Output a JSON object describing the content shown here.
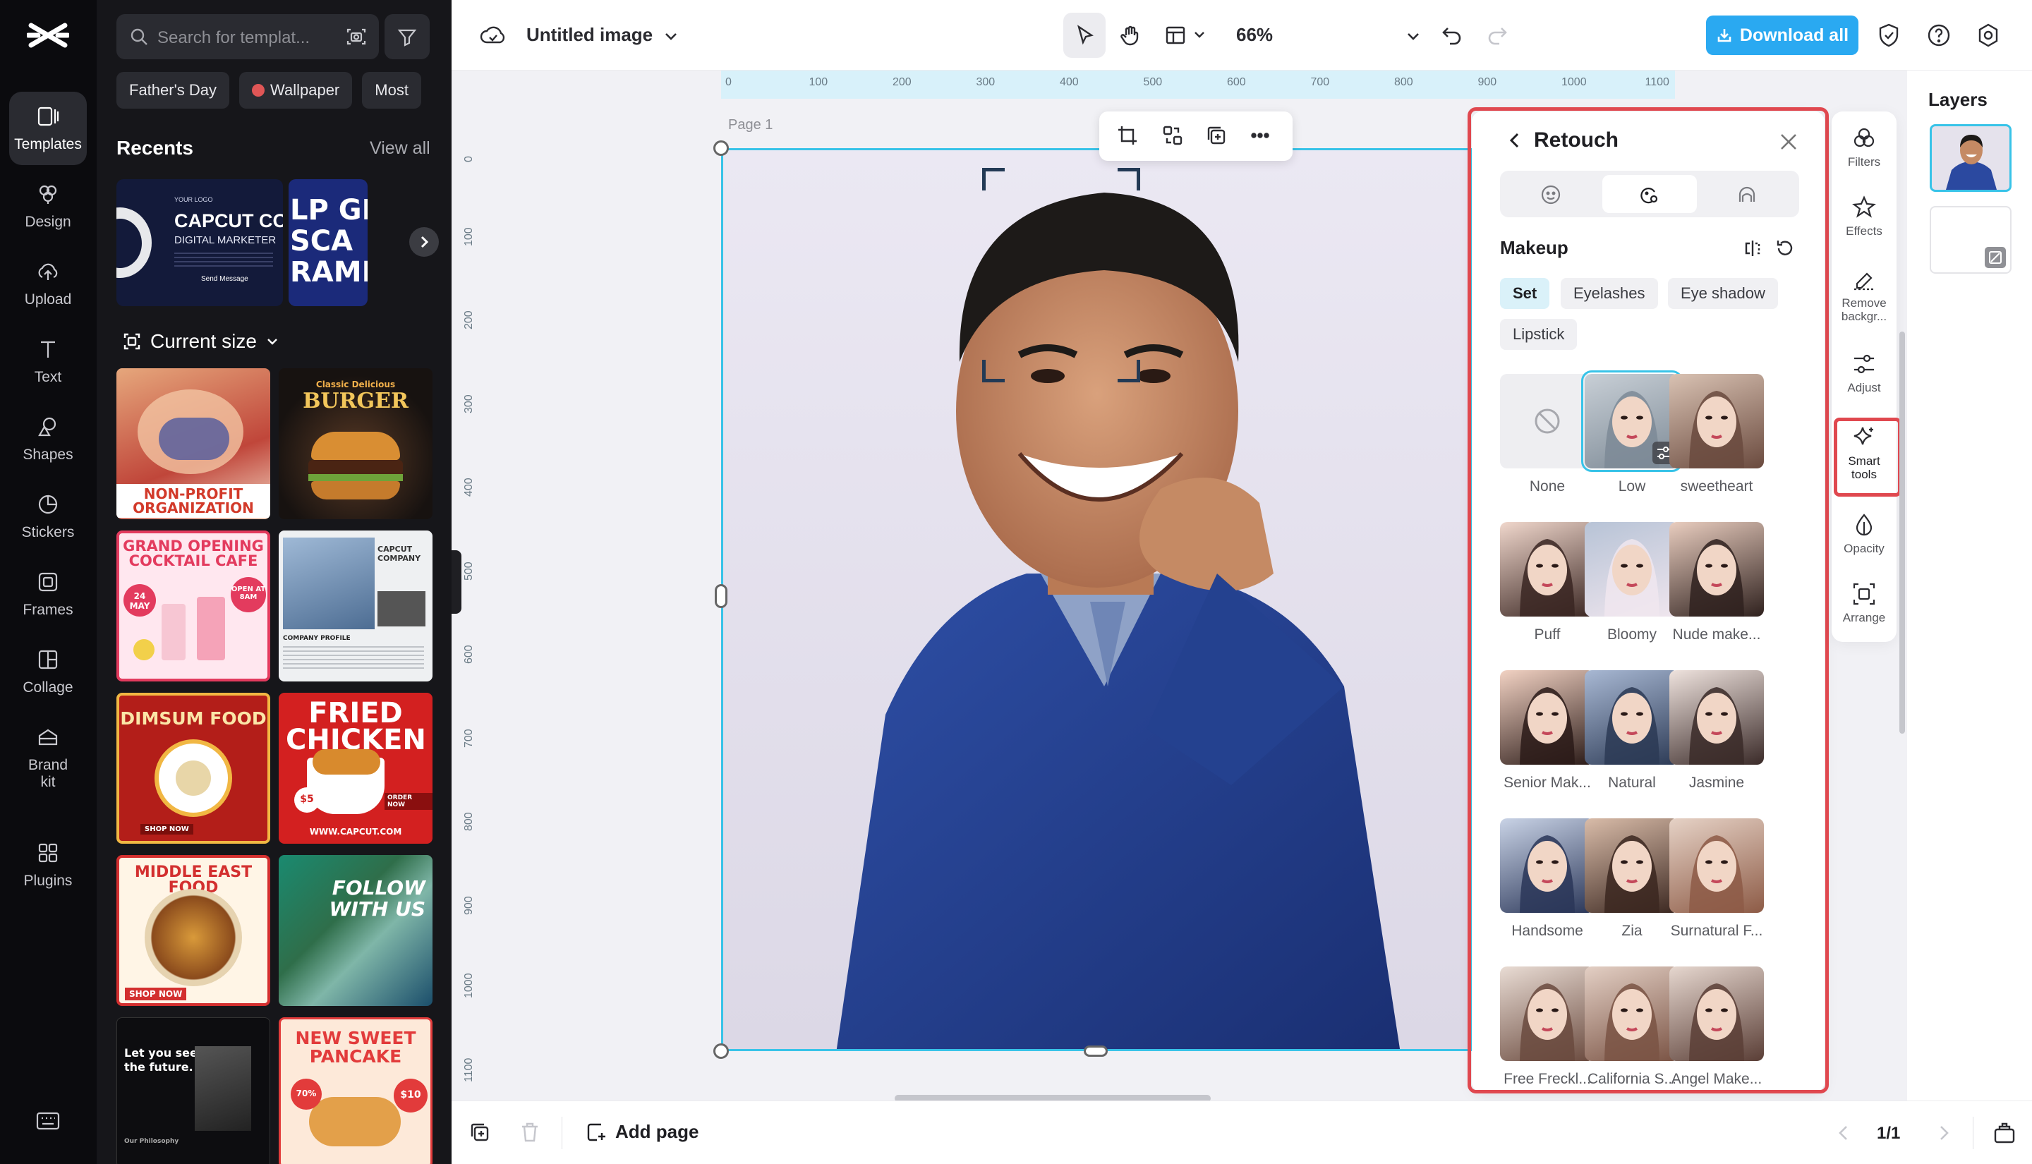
{
  "rail": {
    "items": [
      {
        "label": "Templates",
        "icon": "templates-icon"
      },
      {
        "label": "Design",
        "icon": "design-icon"
      },
      {
        "label": "Upload",
        "icon": "upload-icon"
      },
      {
        "label": "Text",
        "icon": "text-icon"
      },
      {
        "label": "Shapes",
        "icon": "shapes-icon"
      },
      {
        "label": "Stickers",
        "icon": "stickers-icon"
      },
      {
        "label": "Frames",
        "icon": "frames-icon"
      },
      {
        "label": "Collage",
        "icon": "collage-icon"
      },
      {
        "label": "Brand kit",
        "icon": "brand-kit-icon"
      },
      {
        "label": "Plugins",
        "icon": "plugins-icon"
      }
    ]
  },
  "templates": {
    "search_placeholder": "Search for templat...",
    "chips": [
      "Father's Day",
      "Wallpaper",
      "Most"
    ],
    "recents_title": "Recents",
    "view_all": "View all",
    "current_size": "Current size",
    "recent_cards": [
      {
        "line1": "CAPCUT COMPA",
        "line2": "DIGITAL MARKETER",
        "small": "YOUR LOGO",
        "button": "Send Message"
      },
      {
        "line1": "LP GRI",
        "line2": "SCA",
        "line3": "RAMMI"
      }
    ],
    "cards": [
      {
        "title": "NON-PROFIT ORGANIZATION"
      },
      {
        "title": "BURGER",
        "sub": "Classic Delicious"
      },
      {
        "title": "GRAND OPENING COCKTAIL CAFE",
        "badge": "24 MAY",
        "badge2": "OPEN AT 8AM"
      },
      {
        "title": "CAPCUT COMPANY",
        "sub": "COMPANY PROFILE"
      },
      {
        "title": "DIMSUM FOOD",
        "sub": "SHOP NOW"
      },
      {
        "title": "FRIED CHICKEN",
        "sub": "WWW.CAPCUT.COM",
        "price": "$5",
        "order": "ORDER NOW"
      },
      {
        "title": "MIDDLE EAST FOOD",
        "sub": "SHOP NOW"
      },
      {
        "title": "FOLLOW WITH US"
      },
      {
        "title": "Let you see the future.",
        "sub": "Our Philosophy"
      },
      {
        "title": "NEW SWEET PANCAKE",
        "price": "$10",
        "pct": "70%"
      }
    ]
  },
  "topbar": {
    "doc_title": "Untitled image",
    "zoom": "66%",
    "download": "Download all"
  },
  "canvas": {
    "page_label": "Page 1",
    "ruler_top": [
      "0",
      "100",
      "200",
      "300",
      "400",
      "500",
      "600",
      "700",
      "800",
      "900",
      "1000",
      "1100"
    ],
    "ruler_left": [
      "0",
      "100",
      "200",
      "300",
      "400",
      "500",
      "600",
      "700",
      "800",
      "900",
      "1000",
      "1100"
    ]
  },
  "retouch": {
    "title": "Retouch",
    "section": "Makeup",
    "chips": [
      "Set",
      "Eyelashes",
      "Eye shadow",
      "Lipstick"
    ],
    "items": [
      {
        "label": "None"
      },
      {
        "label": "Low"
      },
      {
        "label": "sweetheart"
      },
      {
        "label": "Puff"
      },
      {
        "label": "Bloomy"
      },
      {
        "label": "Nude make..."
      },
      {
        "label": "Senior Mak..."
      },
      {
        "label": "Natural"
      },
      {
        "label": "Jasmine"
      },
      {
        "label": "Handsome"
      },
      {
        "label": "Zia"
      },
      {
        "label": "Surnatural F..."
      },
      {
        "label": "Free Freckl..."
      },
      {
        "label": "California S..."
      },
      {
        "label": "Angel Make..."
      }
    ]
  },
  "tools": {
    "items": [
      "Filters",
      "Effects",
      "Remove backgr...",
      "Adjust",
      "Smart tools",
      "Opacity",
      "Arrange"
    ]
  },
  "layers": {
    "title": "Layers"
  },
  "bottombar": {
    "add_page": "Add page",
    "pager": "1/1"
  },
  "colors": {
    "accent": "#2aa9f1",
    "selection": "#38c3e8",
    "highlight": "#e0484f"
  }
}
